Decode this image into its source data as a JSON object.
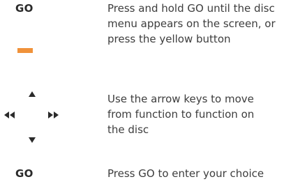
{
  "rows": [
    {
      "key_label": "GO",
      "lines": [
        "Press and hold GO until the disc",
        "menu appears on the screen, or",
        "press the yellow button"
      ]
    },
    {
      "key_label": "",
      "lines": [
        "Use the arrow keys to move",
        "from function to function on",
        "the disc"
      ]
    },
    {
      "key_label": "GO",
      "lines": [
        "Press GO to enter your choice"
      ]
    }
  ],
  "colors": {
    "yellow_button": "#f0923a",
    "arrow_keys": "#2a2a2a"
  },
  "icons": {
    "yellow_button": "yellow-button-icon",
    "arrow_up": "arrow-up-icon",
    "arrow_down": "arrow-down-icon",
    "arrow_left": "fast-rewind-icon",
    "arrow_right": "fast-forward-icon"
  }
}
